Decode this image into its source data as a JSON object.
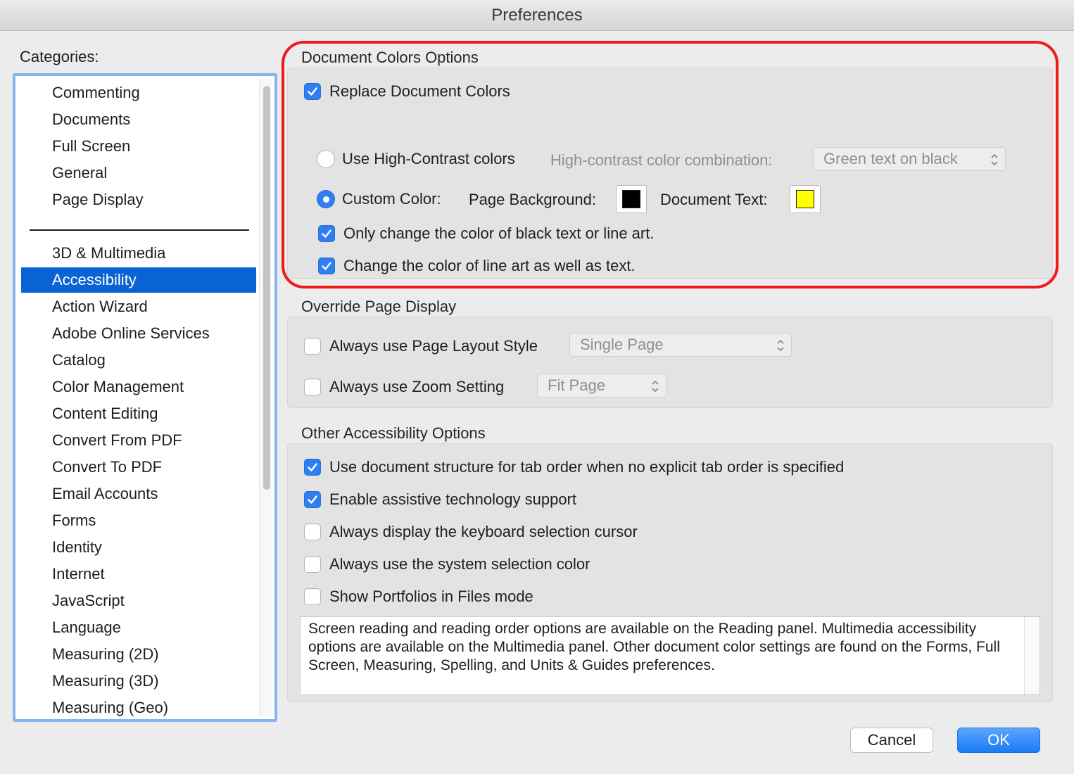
{
  "window": {
    "title": "Preferences"
  },
  "categories": {
    "label": "Categories:",
    "group1": [
      "Commenting",
      "Documents",
      "Full Screen",
      "General",
      "Page Display"
    ],
    "group2": [
      "3D & Multimedia",
      "Accessibility",
      "Action Wizard",
      "Adobe Online Services",
      "Catalog",
      "Color Management",
      "Content Editing",
      "Convert From PDF",
      "Convert To PDF",
      "Email Accounts",
      "Forms",
      "Identity",
      "Internet",
      "JavaScript",
      "Language",
      "Measuring (2D)",
      "Measuring (3D)",
      "Measuring (Geo)"
    ],
    "selected": "Accessibility"
  },
  "document_colors": {
    "title": "Document Colors Options",
    "replace_label": "Replace Document Colors",
    "replace_checked": true,
    "high_contrast_label": "Use High-Contrast colors",
    "high_contrast_selected": false,
    "combination_label": "High-contrast color combination:",
    "combination_value": "Green text on black",
    "custom_label": "Custom Color:",
    "custom_selected": true,
    "page_bg_label": "Page Background:",
    "page_bg_color": "#000000",
    "doc_text_label": "Document Text:",
    "doc_text_color": "#ffff00",
    "only_black_label": "Only change the color of black text or line art.",
    "only_black_checked": true,
    "line_art_label": "Change the color of line art as well as text.",
    "line_art_checked": true
  },
  "override": {
    "title": "Override Page Display",
    "layout_label": "Always use Page Layout Style",
    "layout_checked": false,
    "layout_value": "Single Page",
    "zoom_label": "Always use Zoom Setting",
    "zoom_checked": false,
    "zoom_value": "Fit Page"
  },
  "other": {
    "title": "Other Accessibility Options",
    "options": [
      {
        "label": "Use document structure for tab order when no explicit tab order is specified",
        "checked": true
      },
      {
        "label": "Enable assistive technology support",
        "checked": true
      },
      {
        "label": "Always display the keyboard selection cursor",
        "checked": false
      },
      {
        "label": "Always use the system selection color",
        "checked": false
      },
      {
        "label": "Show Portfolios in Files mode",
        "checked": false
      }
    ],
    "info_text": "Screen reading and reading order options are available on the Reading panel. Multimedia accessibility options are available on the Multimedia panel. Other document color settings are found on the Forms, Full Screen, Measuring, Spelling, and Units & Guides preferences."
  },
  "buttons": {
    "cancel": "Cancel",
    "ok": "OK"
  },
  "colors": {
    "accent": "#0a63d4",
    "highlight": "#ee1b1b",
    "checkbox": "#2f7ff2"
  }
}
